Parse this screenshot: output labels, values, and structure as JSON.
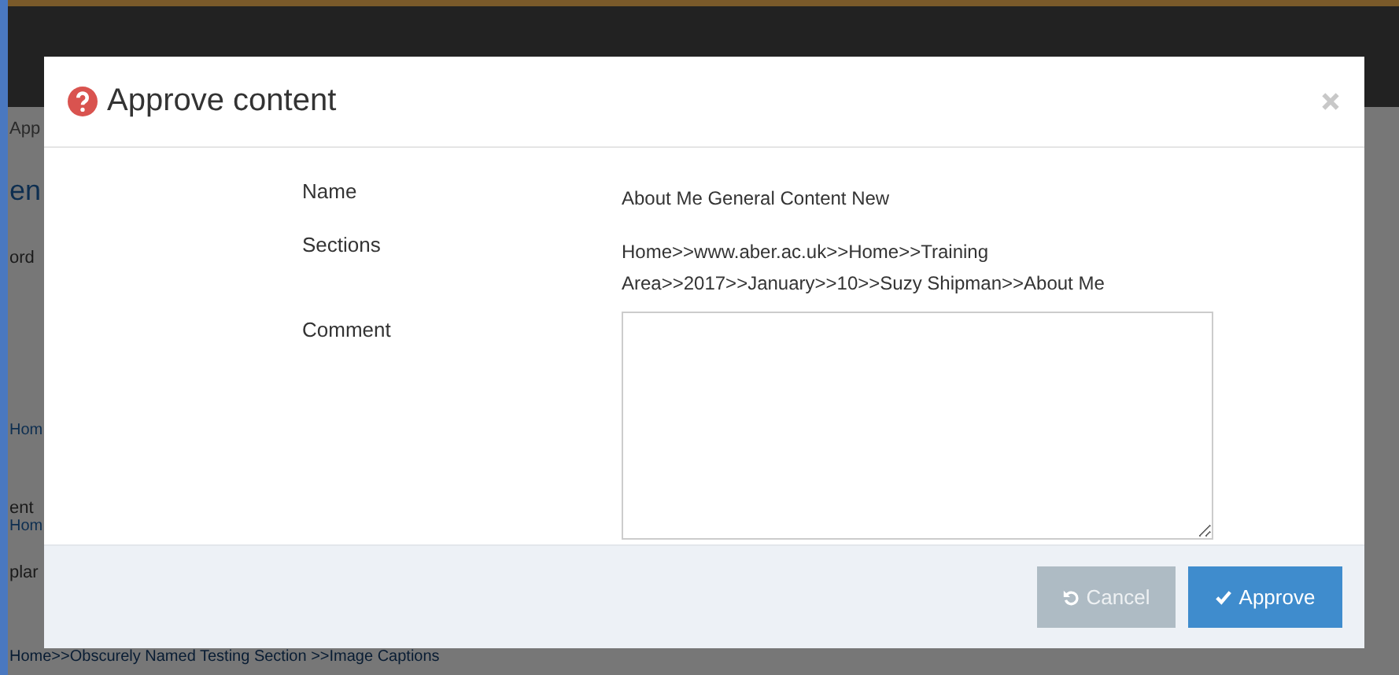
{
  "background_page": {
    "fragments": [
      {
        "text": "App",
        "kind": "tab"
      },
      {
        "text": "en",
        "kind": "heading"
      },
      {
        "text": "ord",
        "kind": "text"
      },
      {
        "text": "Hom",
        "kind": "link"
      },
      {
        "text": "ent",
        "kind": "text"
      },
      {
        "text": "Hom",
        "kind": "link"
      },
      {
        "text": "plar",
        "kind": "text"
      },
      {
        "text": "Home>>Obscurely Named Testing Section >>Image Captions",
        "kind": "link"
      }
    ]
  },
  "dialog": {
    "title": "Approve content",
    "fields": [
      {
        "label": "Name",
        "value": "About Me General Content New",
        "kind": "text"
      },
      {
        "label": "Sections",
        "value": "Home>>www.aber.ac.uk>>Home>>Training Area>>2017>>January>>10>>Suzy Shipman>>About Me",
        "kind": "text"
      },
      {
        "label": "Comment",
        "kind": "textarea"
      }
    ],
    "buttons": [
      {
        "label": "Cancel",
        "kind": "cancel",
        "disabled": true
      },
      {
        "label": "Approve",
        "kind": "approve",
        "disabled": false
      }
    ]
  }
}
